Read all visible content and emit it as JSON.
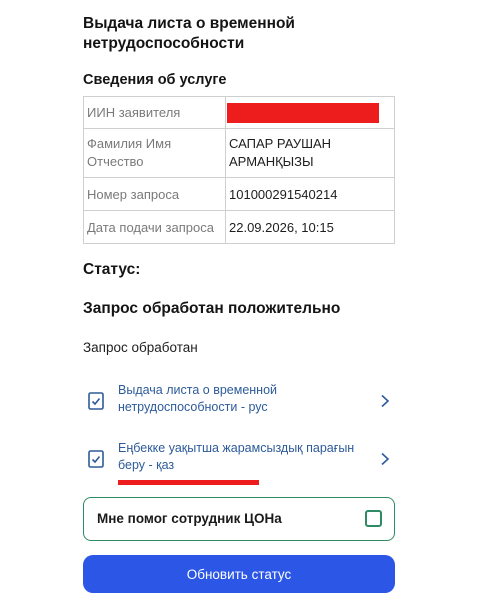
{
  "page": {
    "title": "Выдача листа о временной нетрудоспособности"
  },
  "service_info": {
    "heading": "Сведения об услуге",
    "rows": [
      {
        "label": "ИИН заявителя",
        "value": ""
      },
      {
        "label": "Фамилия Имя Отчество",
        "value": "САПАР РАУШАН АРМАНҚЫЗЫ"
      },
      {
        "label": "Номер запроса",
        "value": "101000291540214"
      },
      {
        "label": "Дата подачи запроса",
        "value": "22.09.2026, 10:15"
      }
    ]
  },
  "status": {
    "label": "Статус:",
    "result": "Запрос обработан положительно",
    "detail": "Запрос обработан"
  },
  "documents": [
    {
      "title": "Выдача листа о временной нетрудоспособности - рус",
      "icon": "document-check-icon"
    },
    {
      "title": "Еңбекке уақытша жарамсыздық парағын беру - қаз",
      "icon": "document-check-icon"
    }
  ],
  "helped": {
    "label": "Мне помог сотрудник ЦОНа",
    "checked": false
  },
  "actions": {
    "refresh_label": "Обновить статус"
  },
  "colors": {
    "link": "#2d5b9a",
    "accent_green": "#2e8b63",
    "primary_button": "#2b56e6",
    "redaction": "#ee1d1d"
  }
}
